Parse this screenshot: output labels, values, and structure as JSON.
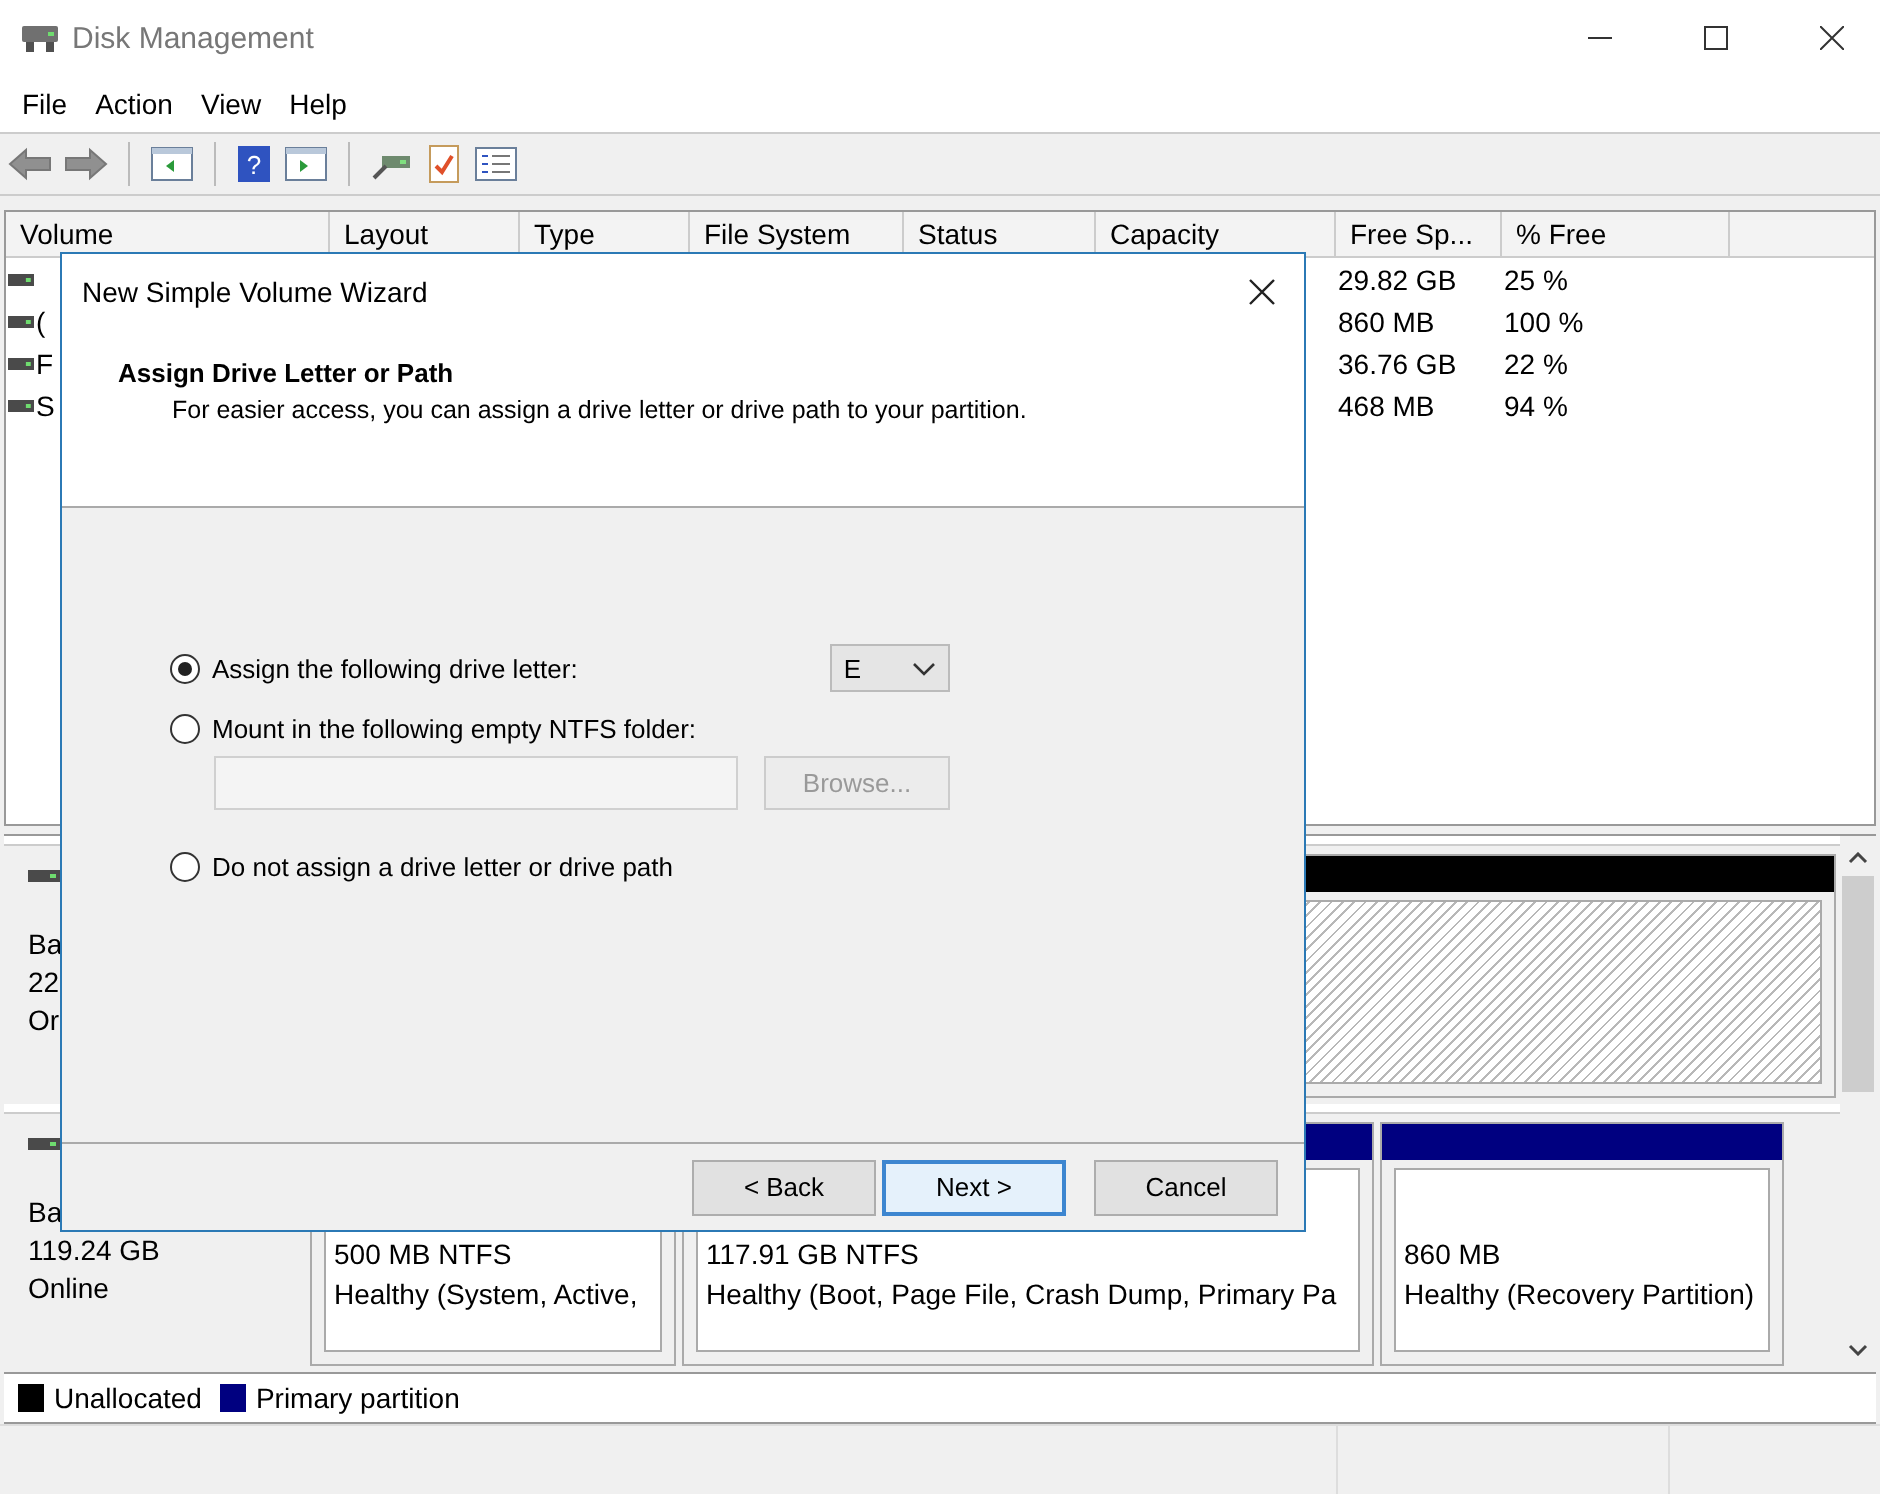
{
  "window": {
    "title": "Disk Management"
  },
  "menu": [
    "File",
    "Action",
    "View",
    "Help"
  ],
  "toolbar": {
    "help_glyph": "?"
  },
  "volume_list": {
    "columns": [
      "Volume",
      "Layout",
      "Type",
      "File System",
      "Status",
      "Capacity",
      "Free Sp...",
      "% Free"
    ],
    "rows": [
      {
        "free": "29.82 GB",
        "pct": "25 %"
      },
      {
        "volume": "(",
        "free": "860 MB",
        "pct": "100 %"
      },
      {
        "volume": "F",
        "free": "36.76 GB",
        "pct": "22 %"
      },
      {
        "volume": "S",
        "free": "468 MB",
        "pct": "94 %"
      }
    ]
  },
  "disks": [
    {
      "label_lines": [
        "Ba",
        "22",
        "Or"
      ],
      "partitions": [
        {
          "kind": "unallocated"
        }
      ]
    },
    {
      "label_lines": [
        "Ba",
        "119.24 GB",
        "Online"
      ],
      "partitions": [
        {
          "kind": "primary",
          "size": "500 MB NTFS",
          "status": "Healthy (System, Active,"
        },
        {
          "kind": "primary",
          "size": "117.91 GB NTFS",
          "status": "Healthy (Boot, Page File, Crash Dump, Primary Pa"
        },
        {
          "kind": "primary",
          "size": "860 MB",
          "status": "Healthy (Recovery Partition)"
        }
      ]
    }
  ],
  "legend": [
    {
      "label": "Unallocated",
      "color": "#000000"
    },
    {
      "label": "Primary partition",
      "color": "#000080"
    }
  ],
  "dialog": {
    "title": "New Simple Volume Wizard",
    "heading": "Assign Drive Letter or Path",
    "subtitle": "For easier access, you can assign a drive letter or drive path to your partition.",
    "options": [
      {
        "kind": "letter",
        "label": "Assign the following drive letter:",
        "selected": true,
        "value": "E"
      },
      {
        "kind": "folder",
        "label": "Mount in the following empty NTFS folder:",
        "selected": false,
        "button": "Browse...",
        "disabled": true
      },
      {
        "kind": "none",
        "label": "Do not assign a drive letter or drive path",
        "selected": false
      }
    ],
    "buttons": [
      {
        "label": "< Back",
        "focused": false
      },
      {
        "label": "Next >",
        "focused": true
      },
      {
        "label": "Cancel",
        "focused": false
      }
    ]
  }
}
